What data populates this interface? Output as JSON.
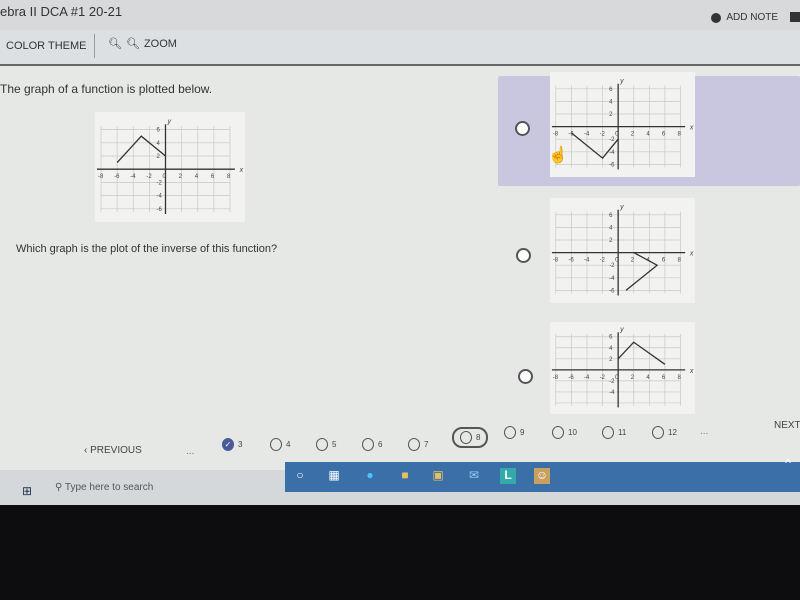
{
  "header": {
    "title": "ebra II DCA #1 20-21",
    "add_note": "ADD NOTE"
  },
  "toolbar": {
    "color_theme": "COLOR THEME",
    "zoom": "ZOOM"
  },
  "question": {
    "prompt": "The graph of a function is plotted below.",
    "ask": "Which graph is the plot of the inverse of this function?"
  },
  "graphs": {
    "question": {
      "xlabel": "x",
      "ylabel": "y",
      "xticks": [
        "-8",
        "-6",
        "-4",
        "-2",
        "0",
        "2",
        "4",
        "6",
        "8"
      ],
      "yticks": [
        "6",
        "4",
        "2",
        "-2",
        "-4",
        "-6"
      ],
      "points": [
        [
          -6,
          1
        ],
        [
          -3,
          5
        ],
        [
          0,
          2
        ]
      ]
    },
    "options": [
      {
        "selected": true,
        "xlabel": "x",
        "ylabel": "y",
        "xticks": [
          "-8",
          "-6",
          "-4",
          "-2",
          "0",
          "2",
          "4",
          "6",
          "8"
        ],
        "yticks": [
          "6",
          "4",
          "2",
          "-2",
          "-4",
          "-6"
        ],
        "points": [
          [
            -6,
            -1
          ],
          [
            -2,
            -5
          ],
          [
            0,
            -2
          ]
        ]
      },
      {
        "selected": false,
        "xlabel": "x",
        "ylabel": "y",
        "xticks": [
          "-8",
          "-6",
          "-4",
          "-2",
          "0",
          "2",
          "4",
          "6",
          "8"
        ],
        "yticks": [
          "6",
          "4",
          "2",
          "-2",
          "-4",
          "-6"
        ],
        "points": [
          [
            2,
            0
          ],
          [
            5,
            -2
          ],
          [
            1,
            -6
          ]
        ]
      },
      {
        "selected": false,
        "xlabel": "x",
        "ylabel": "y",
        "xticks": [
          "-8",
          "-6",
          "-4",
          "-2",
          "0",
          "2",
          "4",
          "6",
          "8"
        ],
        "yticks": [
          "6",
          "4",
          "2",
          "-2",
          "-4"
        ],
        "points": [
          [
            0,
            2
          ],
          [
            2,
            5
          ],
          [
            6,
            1
          ]
        ]
      }
    ]
  },
  "pager": {
    "previous": "PREVIOUS",
    "next": "NEXT",
    "ellipsis": "...",
    "pages": [
      "3",
      "4",
      "5",
      "6",
      "7",
      "8",
      "9",
      "10",
      "11",
      "12"
    ],
    "done_page": "3",
    "current_page": "8"
  },
  "taskbar": {
    "search_placeholder": "Type here to search"
  },
  "colors": {
    "selected_option": "#c9c7e0",
    "taskbar": "#3a6fa8",
    "done": "#4a5a9a"
  }
}
